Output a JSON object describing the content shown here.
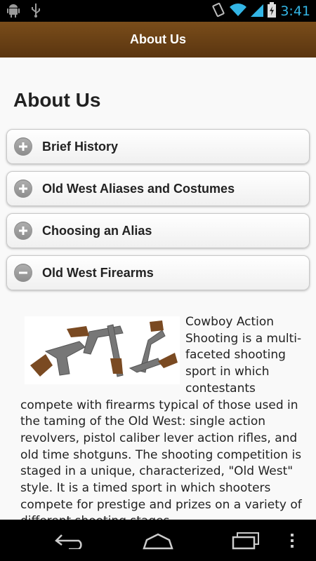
{
  "status_bar": {
    "time": "3:41",
    "icons": [
      "android-debug-icon",
      "usb-icon",
      "vibrate-icon",
      "wifi-icon",
      "signal-icon",
      "battery-icon"
    ],
    "accent": "#33b5e5"
  },
  "header": {
    "title": "About Us",
    "color": "#6b4216"
  },
  "main": {
    "title": "About Us",
    "sections": [
      {
        "label": "Brief History",
        "state": "collapsed",
        "icon": "plus-icon"
      },
      {
        "label": "Old West Aliases and Costumes",
        "state": "collapsed",
        "icon": "plus-icon"
      },
      {
        "label": "Choosing an Alias",
        "state": "collapsed",
        "icon": "plus-icon"
      },
      {
        "label": "Old West Firearms",
        "state": "expanded",
        "icon": "minus-icon"
      }
    ],
    "article": {
      "image": "revolvers-image",
      "text": "Cowboy Action Shooting is a multi-faceted shooting sport in which contestants compete with firearms typical of those used in the taming of the Old West: single action revolvers, pistol caliber lever action rifles, and old time shotguns. The shooting competition is staged in a unique, characterized, \"Old West\" style. It is a timed sport in which shooters compete for prestige and prizes on a variety of different shooting stages."
    }
  },
  "nav_bar": {
    "buttons": [
      "back-icon",
      "home-icon",
      "recent-apps-icon",
      "menu-icon"
    ]
  }
}
